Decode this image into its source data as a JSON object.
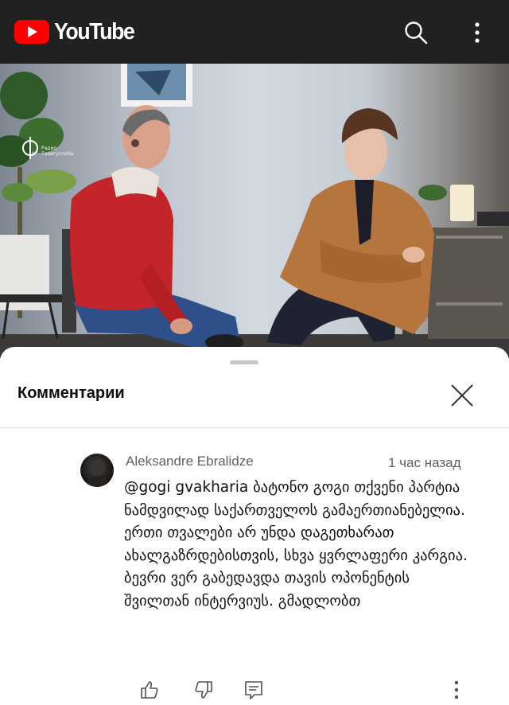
{
  "header": {
    "logo_text": "YouTube",
    "logo_icon": "youtube-play-icon",
    "search_icon": "search-icon",
    "more_icon": "more-vert-icon"
  },
  "video": {
    "watermark_text_line1": "Радио",
    "watermark_text_line2": "Тависуплеба"
  },
  "comments_panel": {
    "title": "Комментарии",
    "close_icon": "close-icon"
  },
  "comment": {
    "author": "Aleksandre Ebralidze",
    "time": "1 час назад",
    "mention": "@gogi gvakharia",
    "text": "ბატონო გოგი თქვენი პარტია ნამდვილად საქართველოს გამაერთიანებელია. ერთი თვალები არ უნდა დაგეთხარათ ახალგაზრდებისთვის, სხვა ყვრლაფერი კარგია. ბევრი ვერ გაბედავდა თავის ოპონენტის შვილთან ინტერვიუს. გმადლობთ",
    "actions": [
      "like-icon",
      "dislike-icon",
      "reply-icon",
      "more-vert-icon"
    ]
  },
  "colors": {
    "topbar": "#212121",
    "youtube_red": "#ff0000",
    "sheet": "#ffffff",
    "meta_text": "#606060"
  }
}
